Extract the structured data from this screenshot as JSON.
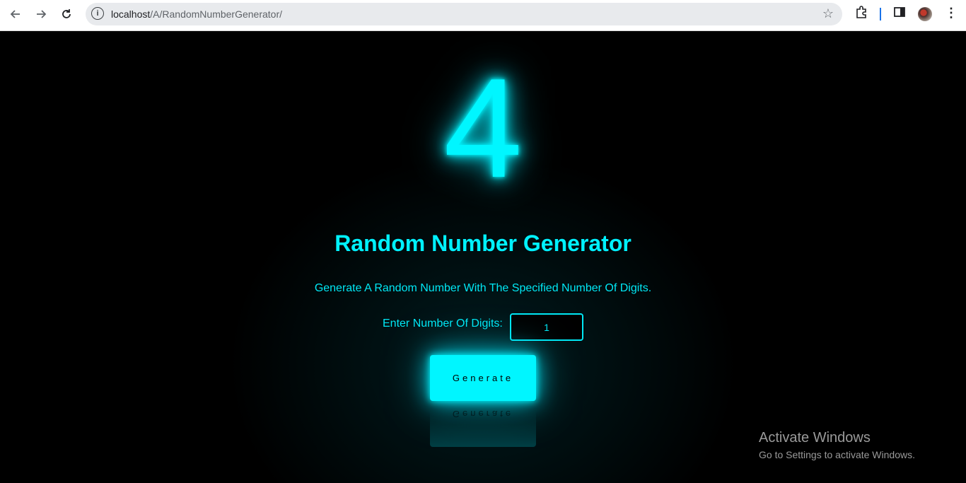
{
  "browser": {
    "url_host": "localhost",
    "url_path": "/A/RandomNumberGenerator/"
  },
  "app": {
    "generated_number": "4",
    "title": "Random Number Generator",
    "subtitle": "Generate A Random Number With The Specified Number Of Digits.",
    "digits_label": "Enter Number Of Digits:",
    "digits_value": "1",
    "generate_label": "Generate",
    "accent_color": "#00f6ff"
  },
  "watermark": {
    "line1": "Activate Windows",
    "line2": "Go to Settings to activate Windows."
  }
}
